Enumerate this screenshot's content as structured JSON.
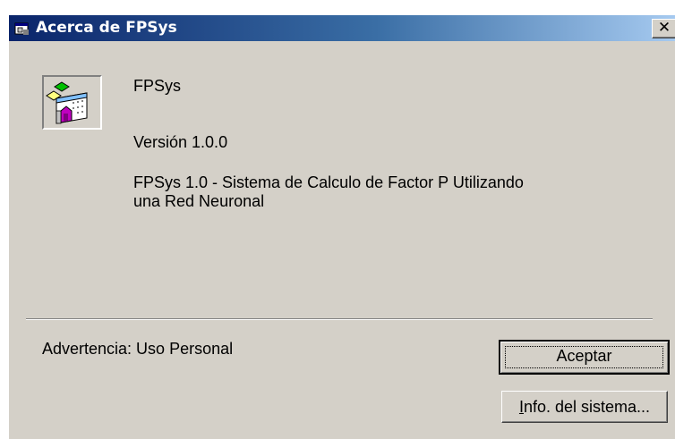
{
  "window": {
    "title": "Acerca de FPSys",
    "close_glyph": "✕"
  },
  "about": {
    "app_name": "FPSys",
    "version": "Versión 1.0.0",
    "description_line1": "FPSys 1.0 - Sistema de Calculo de Factor P Utilizando",
    "description_line2": "una Red Neuronal",
    "warning": "Advertencia: Uso Personal"
  },
  "buttons": {
    "ok_label": "Aceptar",
    "sysinfo_mnemonic": "I",
    "sysinfo_rest": "nfo. del sistema..."
  },
  "icons": {
    "title_icon": "app-small-icon",
    "app_icon": "fpsys-app-icon",
    "close_icon": "close-icon"
  },
  "colors": {
    "face": "#d4d0c8",
    "titlebar_start": "#0a246a",
    "titlebar_end": "#a6caf0",
    "title_text": "#ffffff"
  }
}
